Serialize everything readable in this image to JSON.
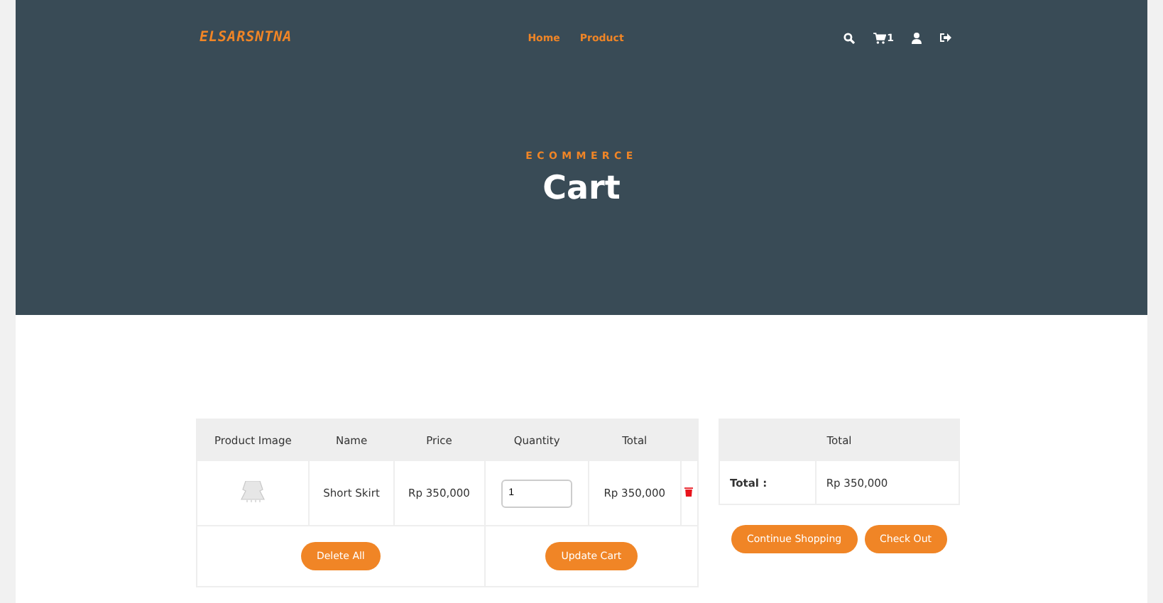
{
  "nav": {
    "logo": "ELSARSNTNA",
    "links": [
      {
        "label": "Home",
        "selected": false
      },
      {
        "label": "Product",
        "selected": false
      }
    ],
    "cart_count": "1"
  },
  "hero": {
    "eyebrow": "ECOMMERCE",
    "title": "Cart"
  },
  "cart_table": {
    "columns": [
      "Product Image",
      "Name",
      "Price",
      "Quantity",
      "Total"
    ],
    "rows": [
      {
        "name": "Short Skirt",
        "price": "Rp 350,000",
        "quantity": "1",
        "total": "Rp 350,000"
      }
    ],
    "buttons": [
      "Delete All",
      "Update Cart"
    ]
  },
  "summary": {
    "heading": "Total",
    "label": "Total :",
    "value": "Rp 350,000",
    "buttons": [
      "Continue Shopping",
      "Check Out"
    ]
  }
}
